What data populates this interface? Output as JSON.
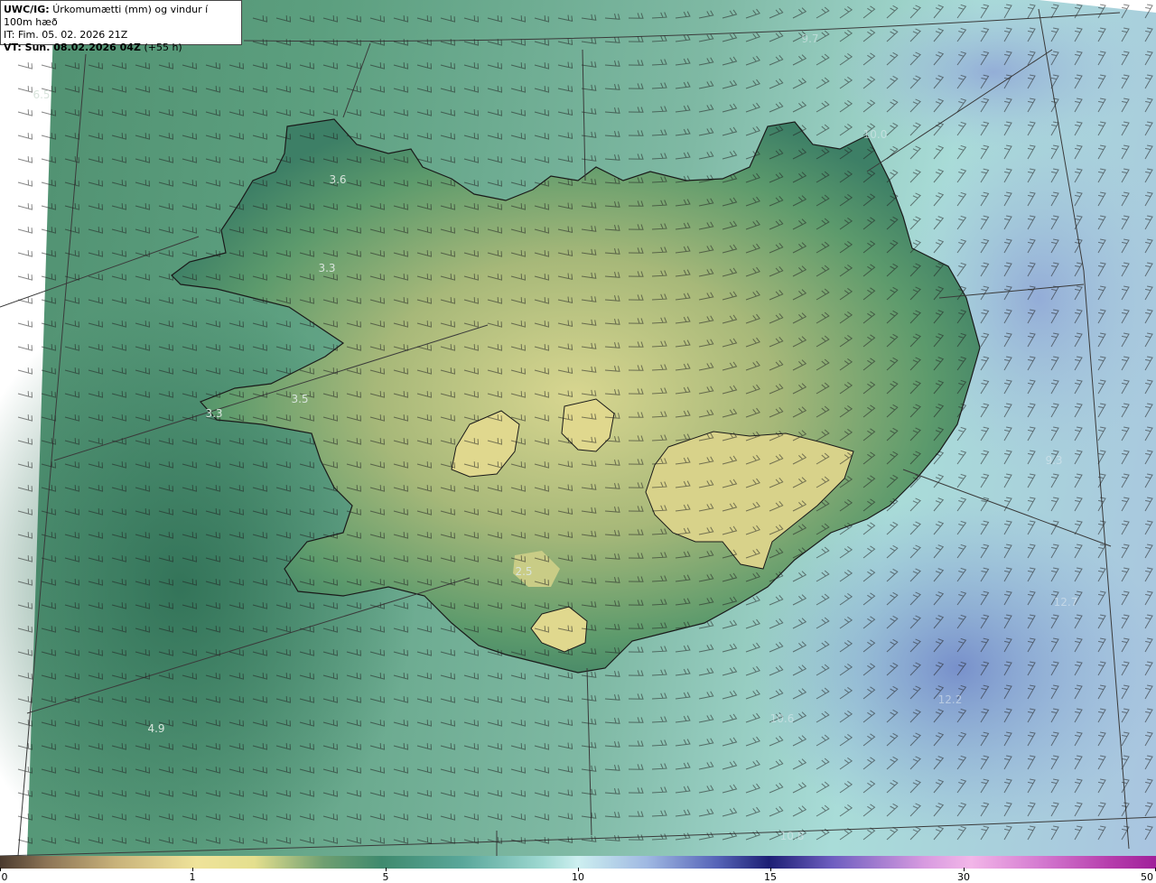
{
  "header": {
    "code": "UWC/IG:",
    "description": "Úrkomumætti (mm) og vindur í 100m hæð",
    "initial_time": "IT: Fim. 05. 02. 2026 21Z",
    "valid_time_label": "VT: Sun. 08.02.2026 04Z",
    "lead_time": "(+55 h)"
  },
  "colors": {
    "coastline": "#1a1a1a",
    "grid_lines": "#3a3a3a",
    "wind_barbs": "#202020",
    "label_text": "#d8e4dc"
  },
  "field_labels": [
    {
      "value": "6.5",
      "faint": false
    },
    {
      "value": "3.6",
      "faint": false
    },
    {
      "value": "3.3",
      "faint": false
    },
    {
      "value": "3.5",
      "faint": false
    },
    {
      "value": "3.3",
      "faint": false
    },
    {
      "value": "2.5",
      "faint": false
    },
    {
      "value": "4.9",
      "faint": false
    },
    {
      "value": "9.7",
      "faint": true
    },
    {
      "value": "10.0",
      "faint": true
    },
    {
      "value": "9.3",
      "faint": true
    },
    {
      "value": "12.7",
      "faint": true
    },
    {
      "value": "12.2",
      "faint": true
    },
    {
      "value": "10.6",
      "faint": true
    },
    {
      "value": "10.8",
      "faint": true
    }
  ],
  "colorbar": {
    "unit": "mm",
    "ticks": [
      "0",
      "1",
      "5",
      "10",
      "15",
      "30",
      "50"
    ]
  }
}
